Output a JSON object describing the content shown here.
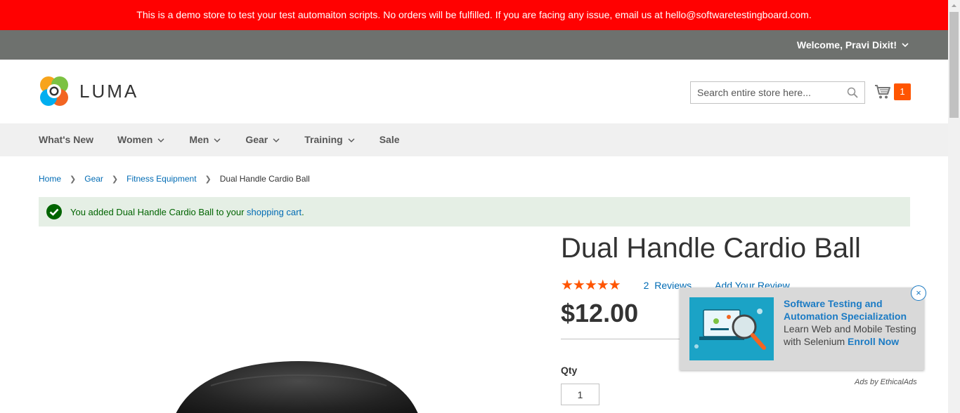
{
  "demo_banner": {
    "text": "This is a demo store to test your test automaiton scripts. No orders will be fulfilled. If you are facing any issue, email us at hello@softwaretestingboard.com."
  },
  "panel": {
    "welcome": "Welcome, Pravi Dixit!"
  },
  "header": {
    "logo_text": "LUMA",
    "search_placeholder": "Search entire store here...",
    "cart_count": "1"
  },
  "nav": {
    "items": [
      {
        "label": "What's New",
        "has_dropdown": false
      },
      {
        "label": "Women",
        "has_dropdown": true
      },
      {
        "label": "Men",
        "has_dropdown": true
      },
      {
        "label": "Gear",
        "has_dropdown": true
      },
      {
        "label": "Training",
        "has_dropdown": true
      },
      {
        "label": "Sale",
        "has_dropdown": false
      }
    ]
  },
  "breadcrumb": {
    "home": "Home",
    "gear": "Gear",
    "fitness": "Fitness Equipment",
    "current": "Dual Handle Cardio Ball"
  },
  "message": {
    "prefix": "You added Dual Handle Cardio Ball to your ",
    "link": "shopping cart",
    "suffix": "."
  },
  "product": {
    "title": "Dual Handle Cardio Ball",
    "stars": "★★★★★",
    "reviews_count": "2",
    "reviews_label": "Reviews",
    "add_review": "Add Your Review",
    "price": "$12.00",
    "qty_label": "Qty",
    "qty_value": "1"
  },
  "ad": {
    "title": "Software Testing and Automation Specialization",
    "body": "Learn Web and Mobile Testing with Selenium",
    "cta": "Enroll Now",
    "close": "×",
    "by": "Ads by EthicalAds"
  },
  "colors": {
    "banner": "#ff0101",
    "panel": "#6e716e",
    "link": "#006bb4",
    "accent": "#ff5501",
    "success_bg": "#e5efe5",
    "success_text": "#006400"
  }
}
